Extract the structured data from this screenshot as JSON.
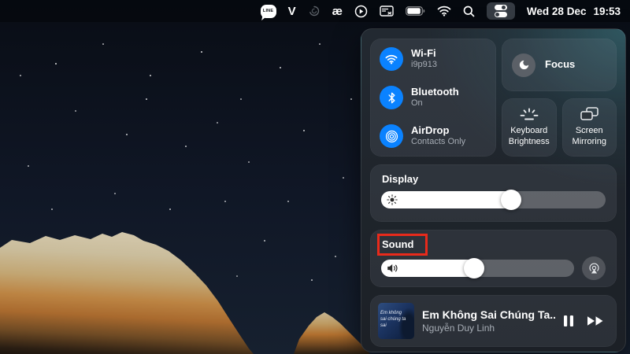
{
  "menu_bar": {
    "line_label": "LINE",
    "v_label": "V",
    "ae_label": "æ",
    "date": "Wed 28 Dec",
    "time": "19:53"
  },
  "control_center": {
    "wifi": {
      "label": "Wi-Fi",
      "status": "i9p913"
    },
    "bluetooth": {
      "label": "Bluetooth",
      "status": "On"
    },
    "airdrop": {
      "label": "AirDrop",
      "status": "Contacts Only"
    },
    "focus": {
      "label": "Focus"
    },
    "keyboard_brightness": {
      "label": "Keyboard Brightness"
    },
    "screen_mirroring": {
      "label": "Screen Mirroring"
    },
    "display": {
      "label": "Display",
      "brightness_pct": 58
    },
    "sound": {
      "label": "Sound",
      "volume_pct": 48
    },
    "now_playing": {
      "title": "Em Không Sai Chúng Ta...",
      "artist": "Nguyễn Duy Linh",
      "album_art_text": "Em không sai chúng ta sai"
    }
  },
  "colors": {
    "accent_blue": "#0a82ff",
    "annotation_red": "#e82a1b",
    "panel_teal_glow": "#3a7c86",
    "slider_fill": "#ffffff",
    "subtext_gray": "#a7adb5"
  }
}
